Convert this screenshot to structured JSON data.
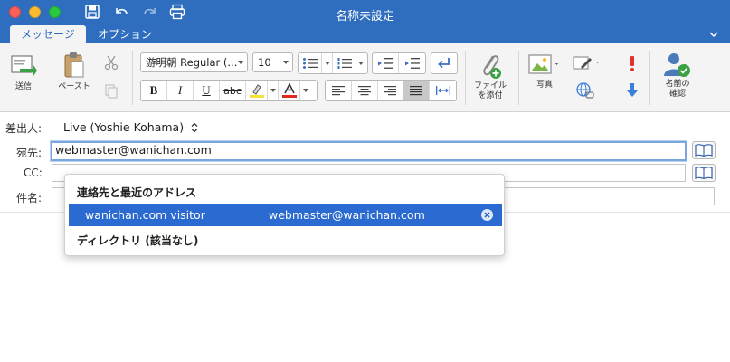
{
  "window": {
    "title": "名称未設定"
  },
  "tabs": {
    "message": "メッセージ",
    "options": "オプション"
  },
  "ribbon": {
    "send": "送信",
    "paste": "ペースト",
    "font_name": "游明朝 Regular (...",
    "font_size": "10",
    "bold": "B",
    "italic": "I",
    "underline": "U",
    "strikethrough": "abc",
    "attach_line1": "ファイル",
    "attach_line2": "を添付",
    "photo": "写真",
    "check_names_line1": "名前の",
    "check_names_line2": "確認"
  },
  "header": {
    "from_label": "差出人:",
    "from_value": "Live (Yoshie Kohama)",
    "to_label": "宛先:",
    "to_value": "webmaster@wanichan.com",
    "cc_label": "CC:",
    "cc_value": "",
    "subject_label": "件名:",
    "subject_value": ""
  },
  "autocomplete": {
    "section_recent": "連絡先と最近のアドレス",
    "suggestions": [
      {
        "name": "wanichan.com visitor",
        "email": "webmaster@wanichan.com"
      }
    ],
    "section_directory": "ディレクトリ (該当なし)"
  },
  "colors": {
    "accent": "#2f6dbf",
    "selection": "#2a6ad1",
    "highlight_yellow": "#f5e23a",
    "font_red": "#e02a1e",
    "importance_red": "#e0332b",
    "low_importance_blue": "#3a7fd8"
  }
}
